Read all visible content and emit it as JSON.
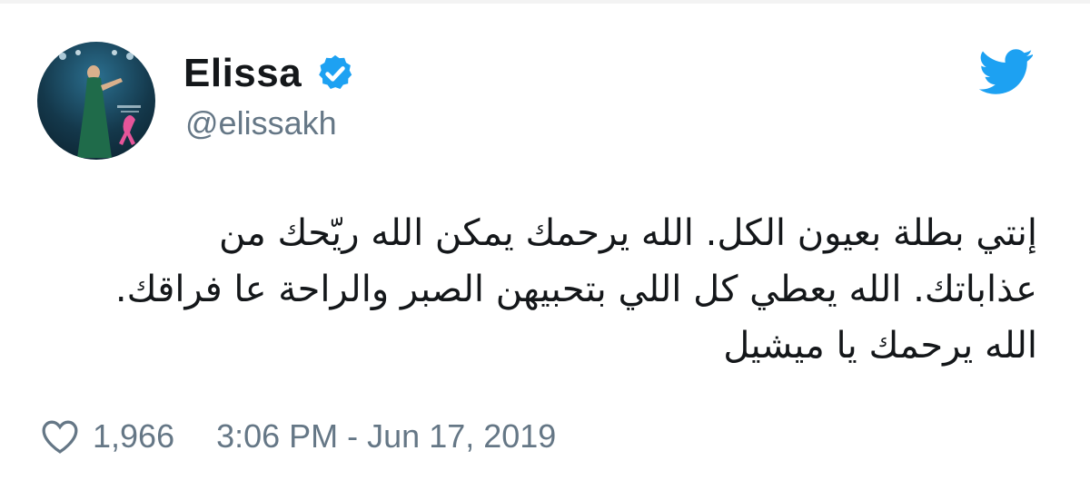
{
  "user": {
    "display_name": "Elissa",
    "handle": "@elissakh"
  },
  "tweet": {
    "lines": [
      "إنتي بطلة بعيون الكل. الله يرحمك يمكن الله ريّحك من",
      "عذاباتك. الله يعطي كل اللي بتحبيهن الصبر والراحة عا فراقك.",
      "الله يرحمك يا ميشيل"
    ],
    "likes": "1,966",
    "timestamp": "3:06 PM - Jun 17, 2019"
  },
  "icons": {
    "verified": "verified-badge-icon",
    "brand": "twitter-bird-icon",
    "like": "heart-icon"
  },
  "colors": {
    "twitter_blue": "#1da1f2",
    "text": "#14171a",
    "muted": "#657786"
  }
}
